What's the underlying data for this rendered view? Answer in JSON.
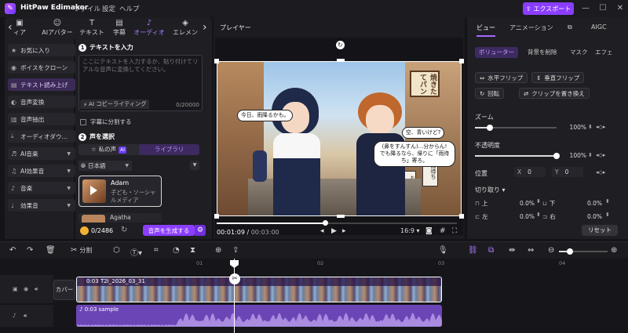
{
  "app": {
    "name": "HitPaw Edimakor",
    "menus": [
      "ファイル",
      "設定",
      "ヘルプ"
    ],
    "export_label": "エクスポート"
  },
  "colors": {
    "accent": "#8b3dff",
    "accent_text": "#b07dff"
  },
  "media_tabs": [
    "ィア",
    "AIアバター",
    "テキスト",
    "字幕",
    "オーディオ",
    "エレメン"
  ],
  "media_tab_icons": [
    "media-icon",
    "avatar-icon",
    "text-icon",
    "subtitle-icon",
    "audio-icon",
    "element-icon"
  ],
  "sidebar": {
    "items": [
      {
        "label": "お気に入り",
        "icon": "star-icon"
      },
      {
        "label": "ボイスをクローン",
        "icon": "clone-icon"
      },
      {
        "label": "テキスト読み上げ",
        "icon": "tts-icon",
        "active": true
      },
      {
        "label": "音声変換",
        "icon": "voice-change-icon"
      },
      {
        "label": "音声抽出",
        "icon": "extract-icon"
      },
      {
        "label": "オーディオダウ...",
        "icon": "download-icon"
      },
      {
        "label": "AI音楽",
        "icon": "ai-music-icon",
        "has_dropdown": true
      },
      {
        "label": "AI効果音",
        "icon": "ai-sfx-icon",
        "has_dropdown": true
      },
      {
        "label": "音楽",
        "icon": "music-icon",
        "has_dropdown": true
      },
      {
        "label": "効果音",
        "icon": "sfx-icon",
        "has_dropdown": true
      }
    ]
  },
  "tts": {
    "step1_title": "テキストを入力",
    "placeholder": "ここにテキストを入力するか、貼り付けてリアルな音声に変換してください。",
    "ai_copy_label": "AI コピーライティング",
    "char_count": "0/20000",
    "split_subtitle_label": "字幕に分割する",
    "step2_title": "声を選択",
    "tab_my_voice": "私の声",
    "tab_ai_badge": "AI",
    "tab_library": "ライブラリ",
    "language": "日本語",
    "voice_card": {
      "name": "Adam",
      "desc": "子ども・ソーシャルメディア"
    },
    "voice_card2": {
      "name": "Agatha"
    },
    "credits": "0/2486",
    "generate_label": "音声を生成する"
  },
  "player": {
    "title": "プレイヤー",
    "bubbles": [
      "今日、雨降るかも。",
      "空、青いけど?",
      "(鼻をすんすん)…分からん!\nでも降るなら、帰りに「雨待ち」寄ろ。"
    ],
    "shop_sign": "焼きたてパン",
    "sign2": "雨待ち",
    "sign3": "おやつ",
    "current_time": "00:01:09",
    "total_time": "00:03:00",
    "progress": 0.45,
    "aspect": "16:9"
  },
  "right_panel": {
    "tabs": [
      "ビュー",
      "アニメーション",
      "AIGC"
    ],
    "subtabs": [
      "ボリューター",
      "背景を削除",
      "マスク",
      "エフェ"
    ],
    "flip_h": "水平フリップ",
    "flip_v": "垂直フリップ",
    "rotate": "回転",
    "replace_clip": "クリップを置き換え",
    "zoom_label": "ズーム",
    "zoom_value": "100%",
    "zoom_fraction": 0.18,
    "opacity_label": "不透明度",
    "opacity_value": "100%",
    "opacity_fraction": 1.0,
    "position_label": "位置",
    "pos_x_label": "X",
    "pos_x": "0",
    "pos_y_label": "Y",
    "pos_y": "0",
    "crop_label": "切り取り",
    "crop": [
      {
        "label": "上",
        "value": "0.0%"
      },
      {
        "label": "下",
        "value": "0.0%"
      },
      {
        "label": "左",
        "value": "0.0%"
      },
      {
        "label": "右",
        "value": "0.0%"
      }
    ],
    "reset_label": "リセット"
  },
  "timeline": {
    "split_label": "分割",
    "ruler": [
      "01",
      "02",
      "03",
      "04"
    ],
    "cover_label": "カバー",
    "video_clip_label": "0:03  T2I_2026_03_31",
    "audio_clip_label": "0:03  sample"
  }
}
